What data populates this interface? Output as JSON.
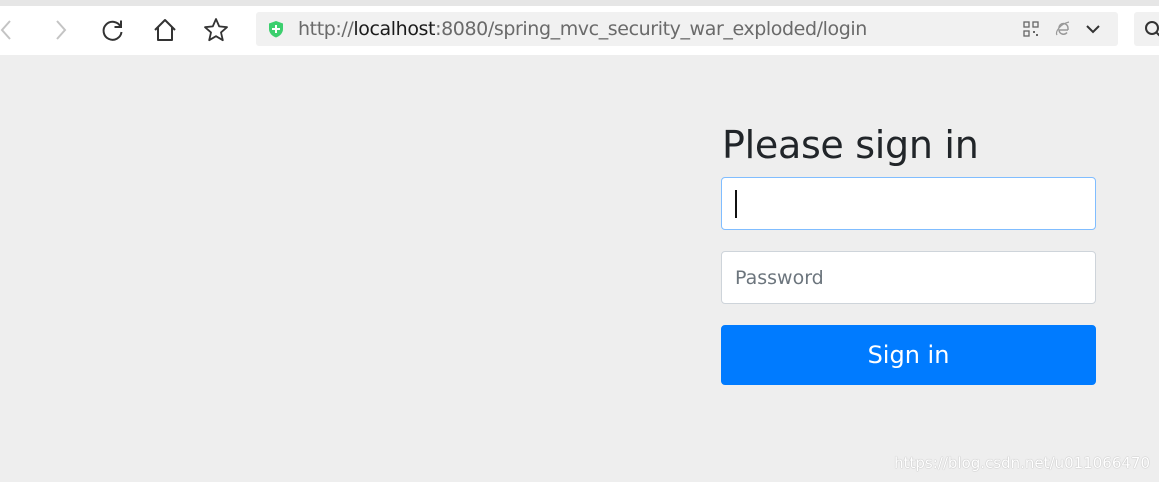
{
  "browser": {
    "url_scheme": "http://",
    "url_host": "localhost",
    "url_rest": ":8080/spring_mvc_security_war_exploded/login",
    "icons": {
      "back": "chevron-left-icon",
      "forward": "chevron-right-icon",
      "reload": "reload-icon",
      "home": "home-icon",
      "bookmark": "star-icon",
      "secure": "shield-plus-icon",
      "qr": "qr-code-icon",
      "ie_mode": "ie-icon",
      "dropdown": "chevron-down-icon",
      "search": "search-icon"
    },
    "secure_color": "#3ccf6e"
  },
  "form": {
    "heading": "Please sign in",
    "username_value": "",
    "username_placeholder": "",
    "password_placeholder": "Password",
    "submit_label": "Sign in",
    "accent_color": "#007bff"
  },
  "watermark": "https://blog.csdn.net/u011066470"
}
